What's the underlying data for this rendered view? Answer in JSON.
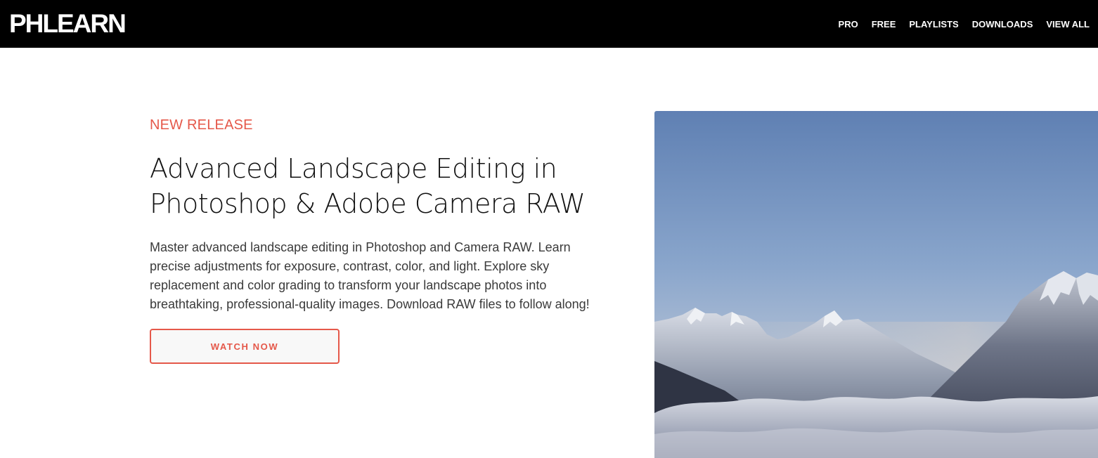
{
  "navbar": {
    "logo": "PHLEARN",
    "links": [
      {
        "label": "PRO"
      },
      {
        "label": "FREE"
      },
      {
        "label": "PLAYLISTS"
      },
      {
        "label": "DOWNLOADS"
      },
      {
        "label": "VIEW ALL"
      }
    ]
  },
  "hero": {
    "eyebrow": "NEW RELEASE",
    "title_line1": "Advanced Landscape Editing in",
    "title_line2": "Photoshop & Adobe Camera RAW",
    "description_line1": "Master advanced landscape editing in Photoshop and Camera RAW. Learn",
    "description_line2": "precise adjustments for exposure, contrast, color, and light. Explore sky",
    "description_line3": "replacement and color grading to transform your landscape photos into",
    "description_line4": "breathtaking, professional-quality images. Download RAW files to follow along!",
    "cta_label": "WATCH NOW",
    "image_subject": "mountain-landscape-image"
  },
  "colors": {
    "accent": "#e5584a",
    "navbar_bg": "#000000",
    "text_dark": "#111111",
    "text_body": "#3a3a3a"
  }
}
